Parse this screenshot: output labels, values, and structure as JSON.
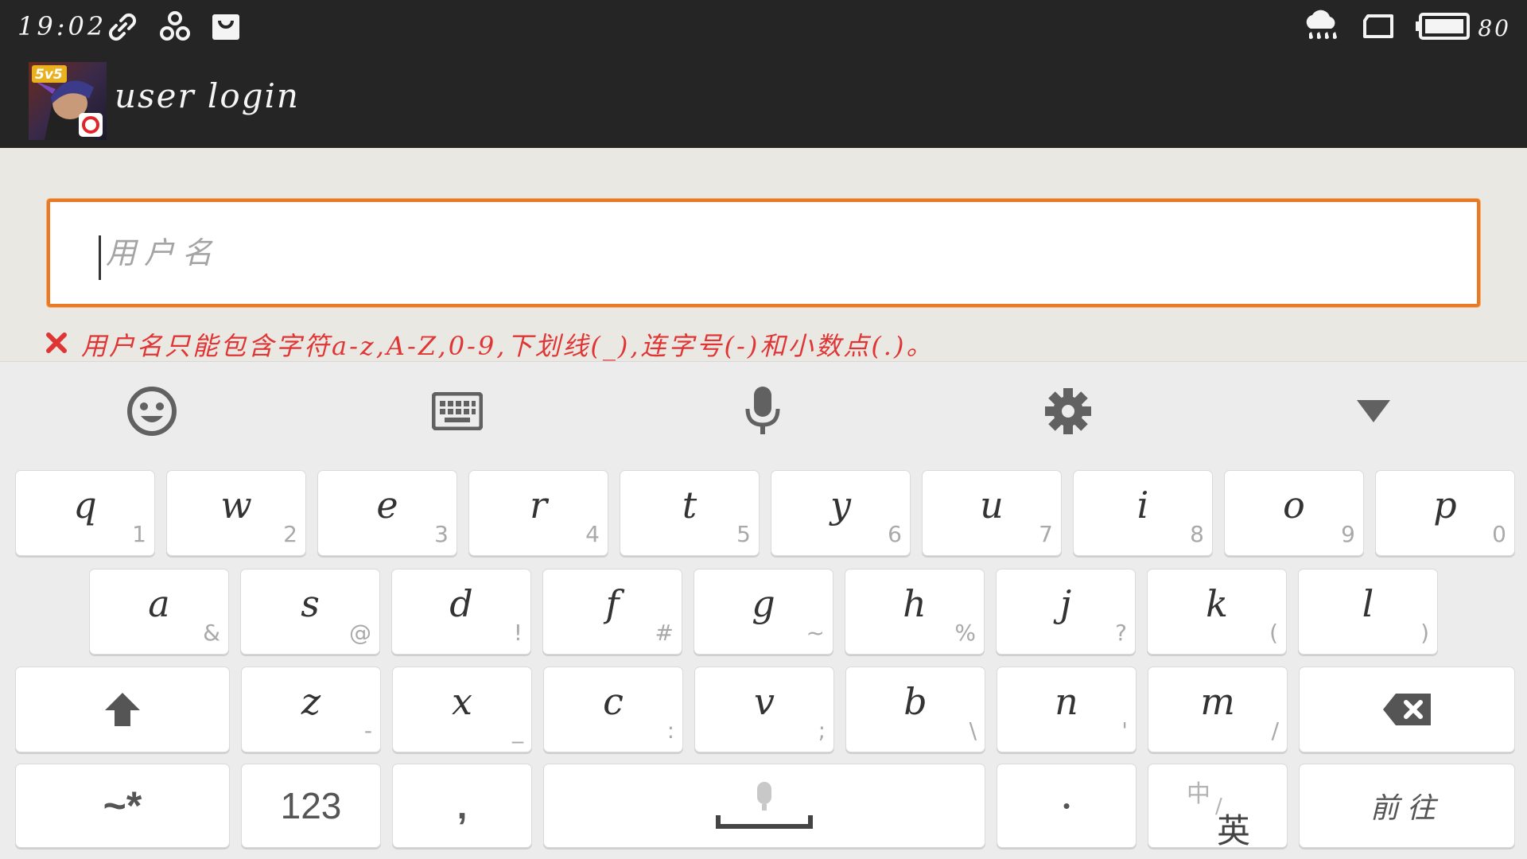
{
  "status_bar": {
    "time": "19:02",
    "battery_level": "80",
    "icons": [
      "link-icon",
      "cluster-icon",
      "bag-icon",
      "rain-cloud-icon",
      "screen-rotate-icon",
      "battery-icon"
    ]
  },
  "title_bar": {
    "app_icon_name": "game-app-icon",
    "app_icon_badge": "5v5",
    "title": "user login"
  },
  "login": {
    "username_placeholder": "用户名",
    "username_value": "",
    "error_message": "用户名只能包含字符a-z,A-Z,0-9,下划线(_),连字号(-)和小数点(.)。"
  },
  "keyboard_toolbar": [
    "emoji-icon",
    "keyboard-icon",
    "microphone-icon",
    "settings-gear-icon",
    "collapse-triangle-icon"
  ],
  "keyboard": {
    "row1": [
      {
        "main": "q",
        "sub": "1"
      },
      {
        "main": "w",
        "sub": "2"
      },
      {
        "main": "e",
        "sub": "3"
      },
      {
        "main": "r",
        "sub": "4"
      },
      {
        "main": "t",
        "sub": "5"
      },
      {
        "main": "y",
        "sub": "6"
      },
      {
        "main": "u",
        "sub": "7"
      },
      {
        "main": "i",
        "sub": "8"
      },
      {
        "main": "o",
        "sub": "9"
      },
      {
        "main": "p",
        "sub": "0"
      }
    ],
    "row2": [
      {
        "main": "a",
        "sub": "&"
      },
      {
        "main": "s",
        "sub": "@"
      },
      {
        "main": "d",
        "sub": "!"
      },
      {
        "main": "f",
        "sub": "#"
      },
      {
        "main": "g",
        "sub": "~"
      },
      {
        "main": "h",
        "sub": "%"
      },
      {
        "main": "j",
        "sub": "?"
      },
      {
        "main": "k",
        "sub": "("
      },
      {
        "main": "l",
        "sub": ")"
      }
    ],
    "row3": [
      {
        "main": "z",
        "sub": "-"
      },
      {
        "main": "x",
        "sub": "_"
      },
      {
        "main": "c",
        "sub": ":"
      },
      {
        "main": "v",
        "sub": ";"
      },
      {
        "main": "b",
        "sub": "\\"
      },
      {
        "main": "n",
        "sub": "'"
      },
      {
        "main": "m",
        "sub": "/"
      }
    ],
    "symbols_label": "~*",
    "numbers_label": "123",
    "comma_label": ",",
    "period_label": "•",
    "lang_zh": "中",
    "lang_slash": "/",
    "lang_en": "英",
    "go_label": "前往"
  },
  "colors": {
    "chrome": "#252525",
    "input_border": "#e97925",
    "error": "#e03535"
  }
}
